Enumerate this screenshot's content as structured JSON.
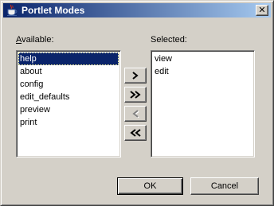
{
  "window": {
    "title": "Portlet Modes",
    "icon": "java-cup-icon",
    "close_glyph": "✕"
  },
  "available": {
    "label_mnemonic": "A",
    "label_rest": "vailable:",
    "items": [
      "help",
      "about",
      "config",
      "edit_defaults",
      "preview",
      "print"
    ],
    "selected_index": 0
  },
  "selected": {
    "label": "Selected:",
    "items": [
      "view",
      "edit"
    ]
  },
  "move_buttons": {
    "add_icon": "chevron-right-icon",
    "add_all_icon": "double-chevron-right-icon",
    "remove_icon": "chevron-left-icon",
    "remove_disabled": true,
    "remove_all_icon": "double-chevron-left-icon"
  },
  "footer": {
    "ok_label": "OK",
    "cancel_label": "Cancel"
  }
}
